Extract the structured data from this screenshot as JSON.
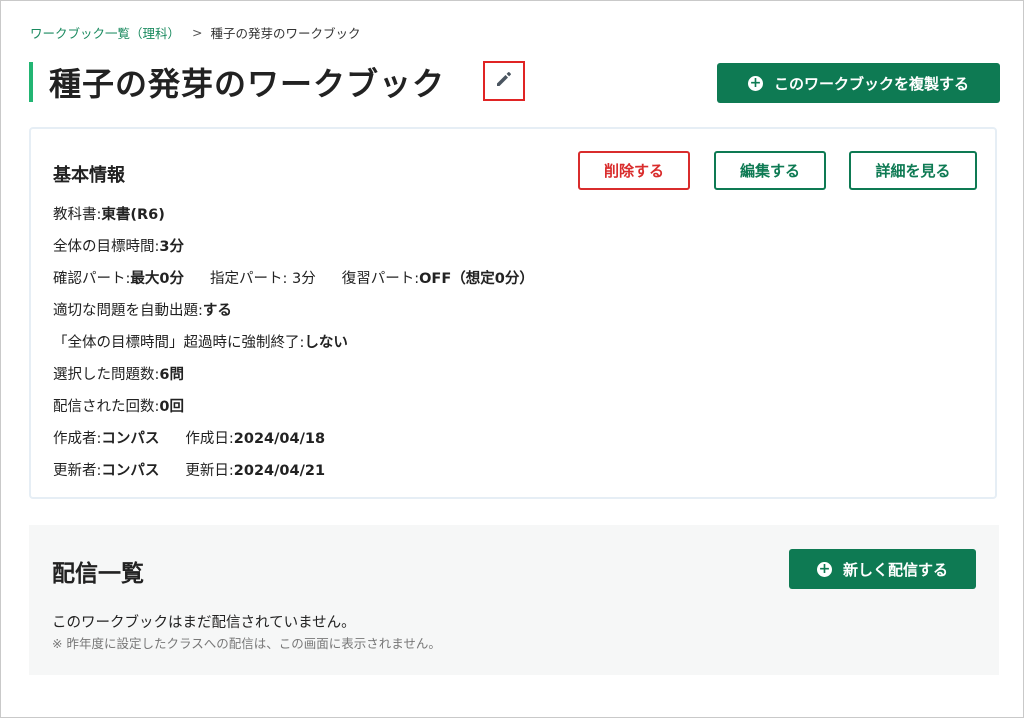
{
  "breadcrumb": {
    "parent": "ワークブック一覧（理科）",
    "separator": ">",
    "current": "種子の発芽のワークブック"
  },
  "page": {
    "title": "種子の発芽のワークブック",
    "edit_icon": "pencil-icon",
    "duplicate_label": "このワークブックを複製する"
  },
  "info": {
    "title": "基本情報",
    "delete_label": "削除する",
    "edit_label": "編集する",
    "detail_label": "詳細を見る",
    "rows": {
      "textbook_label": "教科書: ",
      "textbook_value": "東書(R6)",
      "target_time_label": "全体の目標時間: ",
      "target_time_value": "3分",
      "confirm_part_label": "確認パート: ",
      "confirm_part_value": "最大0分",
      "designated_part": "指定パート: 3分",
      "review_part_label": "復習パート: ",
      "review_part_value": "OFF（想定0分）",
      "auto_question_label": "適切な問題を自動出題: ",
      "auto_question_value": "する",
      "force_end_label": "「全体の目標時間」超過時に強制終了: ",
      "force_end_value": "しない",
      "selected_count_label": "選択した問題数: ",
      "selected_count_value": "6問",
      "delivered_count_label": "配信された回数: ",
      "delivered_count_value": "0回",
      "creator_label": "作成者: ",
      "creator_value": "コンパス",
      "created_date_label": "作成日: ",
      "created_date_value": "2024/04/18",
      "updater_label": "更新者: ",
      "updater_value": "コンパス",
      "updated_date_label": "更新日: ",
      "updated_date_value": "2024/04/21"
    }
  },
  "distribution": {
    "title": "配信一覧",
    "new_label": "新しく配信する",
    "empty_message": "このワークブックはまだ配信されていません。",
    "note": "※ 昨年度に設定したクラスへの配信は、この画面に表示されません。"
  },
  "colors": {
    "accent": "#0e7a53",
    "title_bar": "#22b573",
    "danger": "#d92c2c",
    "highlight_box": "#e02424"
  }
}
